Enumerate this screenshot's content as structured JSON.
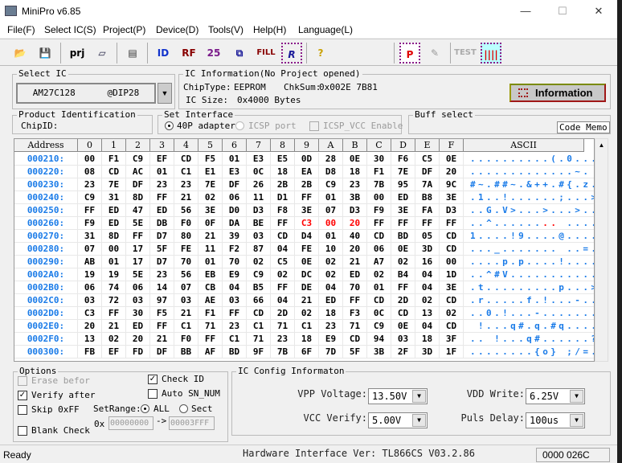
{
  "window": {
    "title": "MiniPro v6.85",
    "minimize": "—",
    "maximize": "☐",
    "close": "✕"
  },
  "menu": [
    "File(F)",
    "Select IC(S)",
    "Project(P)",
    "Device(D)",
    "Tools(V)",
    "Help(H)",
    "Language(L)"
  ],
  "toolbar": {
    "open": "📂",
    "save": "💾",
    "project": "prj",
    "save_project": "▱",
    "device": "▤",
    "read_id": "ID",
    "read": "RF",
    "blank": "25",
    "verify": "⧉",
    "fill": "FILL",
    "readall": "R",
    "help": "?",
    "program": "P",
    "edit": "✎",
    "test": "TEST",
    "pins": "||||"
  },
  "select_ic": {
    "legend": "Select IC",
    "value": "AM27C128      @DIP28"
  },
  "ic_info": {
    "legend": "IC Information(No Project opened)",
    "chip_type_label": "ChipType:",
    "chip_type": "EEPROM",
    "chksum_label": "ChkSum:",
    "chksum": "0x002E 7B81",
    "size_label": "IC Size:",
    "size": "0x4000 Bytes",
    "info_button": "Information"
  },
  "product_id": {
    "legend": "Product Identification",
    "chipid_label": "ChipID:"
  },
  "interface": {
    "legend": "Set Interface",
    "opt1": "40P adapter",
    "opt2": "ICSP port",
    "icsp_vcc": "ICSP_VCC Enable",
    "selected": "40P adapter"
  },
  "buff": {
    "legend": "Buff select",
    "value": "Code Memo"
  },
  "hex": {
    "headers": [
      "Address",
      "0",
      "1",
      "2",
      "3",
      "4",
      "5",
      "6",
      "7",
      "8",
      "9",
      "A",
      "B",
      "C",
      "D",
      "E",
      "F",
      "ASCII"
    ],
    "highlight_color": "#ff0000",
    "rows": [
      {
        "addr": "000210:",
        "bytes": [
          "00",
          "F1",
          "C9",
          "EF",
          "CD",
          "F5",
          "01",
          "E3",
          "E5",
          "0D",
          "28",
          "0E",
          "30",
          "F6",
          "C5",
          "0E"
        ],
        "ascii": "..........(.0..."
      },
      {
        "addr": "000220:",
        "bytes": [
          "08",
          "CD",
          "AC",
          "01",
          "C1",
          "E1",
          "E3",
          "0C",
          "18",
          "EA",
          "D8",
          "18",
          "F1",
          "7E",
          "DF",
          "20"
        ],
        "ascii": ".............~. "
      },
      {
        "addr": "000230:",
        "bytes": [
          "23",
          "7E",
          "DF",
          "23",
          "23",
          "7E",
          "DF",
          "26",
          "2B",
          "2B",
          "C9",
          "23",
          "7B",
          "95",
          "7A",
          "9C"
        ],
        "ascii": "#~.##~.&++.#{.z."
      },
      {
        "addr": "000240:",
        "bytes": [
          "C9",
          "31",
          "8D",
          "FF",
          "21",
          "02",
          "06",
          "11",
          "D1",
          "FF",
          "01",
          "3B",
          "00",
          "ED",
          "B8",
          "3E"
        ],
        "ascii": ".1..!......;...>"
      },
      {
        "addr": "000250:",
        "bytes": [
          "FF",
          "ED",
          "47",
          "ED",
          "56",
          "3E",
          "D0",
          "D3",
          "F8",
          "3E",
          "07",
          "D3",
          "F9",
          "3E",
          "FA",
          "D3"
        ],
        "ascii": "..G.V>...>...>.."
      },
      {
        "addr": "000260:",
        "bytes": [
          "F9",
          "ED",
          "5E",
          "DB",
          "F0",
          "0F",
          "DA",
          "BE",
          "FF",
          "C3",
          "00",
          "20",
          "FF",
          "FF",
          "FF",
          "FF"
        ],
        "ascii": "..^........ ....",
        "red": [
          9,
          10,
          11
        ]
      },
      {
        "addr": "000270:",
        "bytes": [
          "31",
          "8D",
          "FF",
          "D7",
          "80",
          "21",
          "39",
          "03",
          "CD",
          "D4",
          "01",
          "40",
          "CD",
          "BD",
          "05",
          "CD"
        ],
        "ascii": "1....!9....@...."
      },
      {
        "addr": "000280:",
        "bytes": [
          "07",
          "00",
          "17",
          "5F",
          "FE",
          "11",
          "F2",
          "87",
          "04",
          "FE",
          "10",
          "20",
          "06",
          "0E",
          "3D",
          "CD"
        ],
        "ascii": "..._....... ..=."
      },
      {
        "addr": "000290:",
        "bytes": [
          "AB",
          "01",
          "17",
          "D7",
          "70",
          "01",
          "70",
          "02",
          "C5",
          "0E",
          "02",
          "21",
          "A7",
          "02",
          "16",
          "00"
        ],
        "ascii": "....p.p....!...."
      },
      {
        "addr": "0002A0:",
        "bytes": [
          "19",
          "19",
          "5E",
          "23",
          "56",
          "EB",
          "E9",
          "C9",
          "02",
          "DC",
          "02",
          "ED",
          "02",
          "B4",
          "04",
          "1D"
        ],
        "ascii": "..^#V..........."
      },
      {
        "addr": "0002B0:",
        "bytes": [
          "06",
          "74",
          "06",
          "14",
          "07",
          "CB",
          "04",
          "B5",
          "FF",
          "DE",
          "04",
          "70",
          "01",
          "FF",
          "04",
          "3E"
        ],
        "ascii": ".t.........p...>"
      },
      {
        "addr": "0002C0:",
        "bytes": [
          "03",
          "72",
          "03",
          "97",
          "03",
          "AE",
          "03",
          "66",
          "04",
          "21",
          "ED",
          "FF",
          "CD",
          "2D",
          "02",
          "CD"
        ],
        "ascii": ".r.....f.!...-.."
      },
      {
        "addr": "0002D0:",
        "bytes": [
          "C3",
          "FF",
          "30",
          "F5",
          "21",
          "F1",
          "FF",
          "CD",
          "2D",
          "02",
          "18",
          "F3",
          "0C",
          "CD",
          "13",
          "02"
        ],
        "ascii": "..0.!...-......."
      },
      {
        "addr": "0002E0:",
        "bytes": [
          "20",
          "21",
          "ED",
          "FF",
          "C1",
          "71",
          "23",
          "C1",
          "71",
          "C1",
          "23",
          "71",
          "C9",
          "0E",
          "04",
          "CD"
        ],
        "ascii": " !...q#.q.#q...."
      },
      {
        "addr": "0002F0:",
        "bytes": [
          "13",
          "02",
          "20",
          "21",
          "F0",
          "FF",
          "C1",
          "71",
          "23",
          "18",
          "E9",
          "CD",
          "94",
          "03",
          "18",
          "3F"
        ],
        "ascii": ".. !...q#......?"
      },
      {
        "addr": "000300:",
        "bytes": [
          "FB",
          "EF",
          "FD",
          "DF",
          "BB",
          "AF",
          "BD",
          "9F",
          "7B",
          "6F",
          "7D",
          "5F",
          "3B",
          "2F",
          "3D",
          "1F"
        ],
        "ascii": "........{o} ;/=."
      }
    ]
  },
  "options": {
    "legend": "Options",
    "erase": "Erase befor",
    "verify": "Verify after",
    "skip": "Skip 0xFF",
    "blank": "Blank Check",
    "check_id": "Check ID",
    "auto_sn": "Auto SN_NUM",
    "setrange": "SetRange:",
    "all": "ALL",
    "sect": "Sect",
    "ox": "0x",
    "from": "00000000",
    "arrow": "->",
    "to": "00003FFF",
    "verify_checked": true,
    "check_id_checked": true
  },
  "config": {
    "legend": "IC Config Informaton",
    "vpp_label": "VPP Voltage:",
    "vpp": "13.50V",
    "vcc_label": "VCC Verify:",
    "vcc": "5.00V",
    "vdd_label": "VDD Write:",
    "vdd": "6.25V",
    "puls_label": "Puls Delay:",
    "puls": "100us"
  },
  "status": {
    "text": "Ready",
    "hw": "Hardware Interface Ver: TL866CS V03.2.86",
    "addr": "0000 026C"
  }
}
